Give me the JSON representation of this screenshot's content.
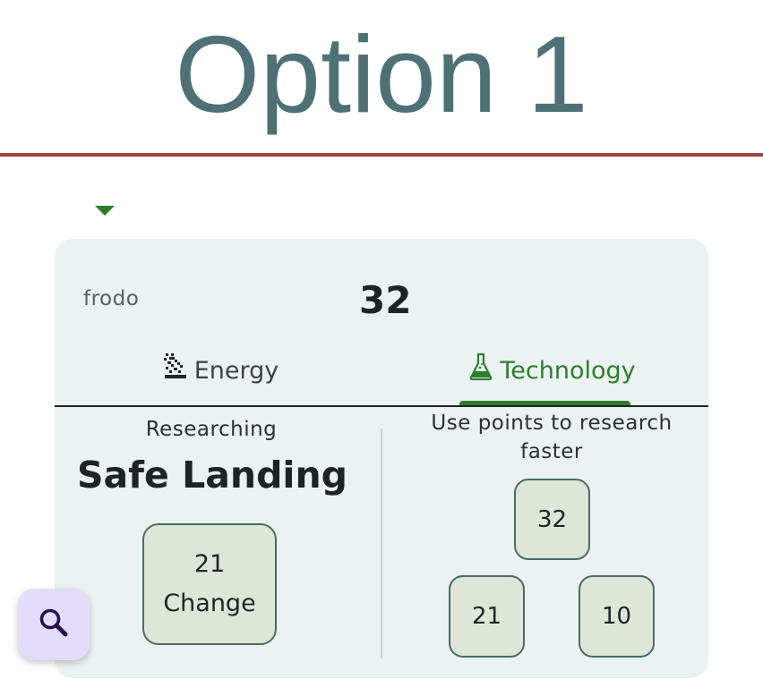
{
  "header": {
    "title": "Option 1"
  },
  "player": {
    "name": "frodo",
    "score": "32"
  },
  "tabs": [
    {
      "label": "Energy",
      "icon": "energy-icon"
    },
    {
      "label": "Technology",
      "icon": "flask-icon",
      "active": true
    }
  ],
  "research": {
    "status_label": "Researching",
    "project": "Safe Landing",
    "change_value": "21",
    "change_label": "Change"
  },
  "points": {
    "instructions": "Use points to research faster",
    "options": [
      "32",
      "21",
      "10"
    ]
  },
  "colors": {
    "title": "#4e7175",
    "accent_rule": "#a14445",
    "active_tab": "#2e7d2e",
    "card_bg": "#eaf3f1",
    "button_bg": "#dee6d7",
    "fab_bg": "#e4dcfb"
  },
  "fab": {
    "icon": "search-icon"
  }
}
